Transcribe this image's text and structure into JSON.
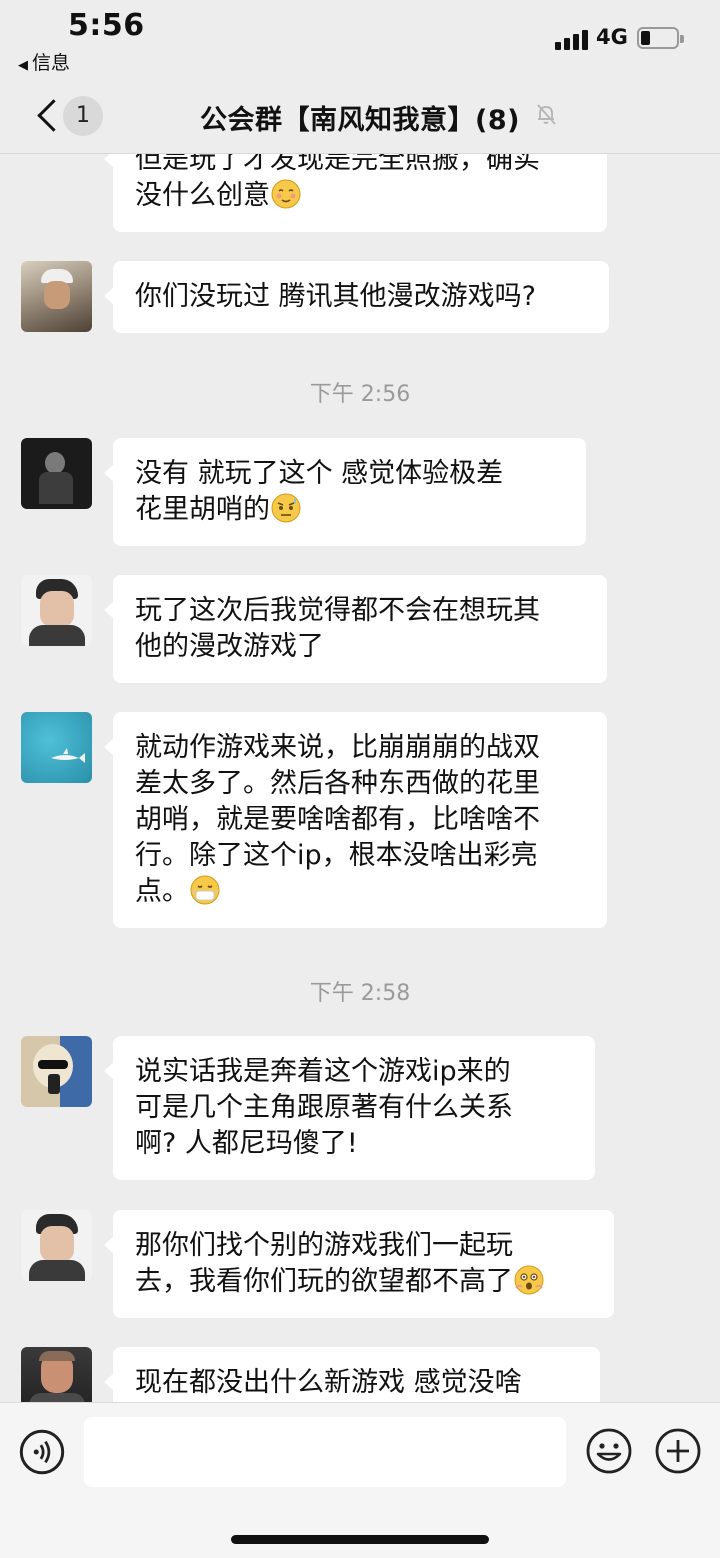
{
  "status_bar": {
    "time": "5:56",
    "back_app": "信息",
    "network": "4G"
  },
  "nav": {
    "unread_count": "1",
    "title": "公会群【南风知我意】(8)"
  },
  "messages": [
    {
      "type": "text",
      "avatar": "avatar-sea",
      "lines": [
        "但是玩了才发现是完全照搬，确实",
        "没什么创意"
      ],
      "emoji": "relieved-face"
    },
    {
      "type": "text",
      "avatar": "avatar-man-cap",
      "lines": [
        "你们没玩过 腾讯其他漫改游戏吗?"
      ]
    },
    {
      "type": "time",
      "text": "下午 2:56"
    },
    {
      "type": "text",
      "avatar": "avatar-dark-figure",
      "lines": [
        "没有  就玩了这个  感觉体验极差",
        "花里胡哨的"
      ],
      "emoji": "sweat-face"
    },
    {
      "type": "text",
      "avatar": "avatar-man-portrait",
      "lines": [
        "玩了这次后我觉得都不会在想玩其",
        "他的漫改游戏了"
      ]
    },
    {
      "type": "text",
      "avatar": "avatar-shark",
      "lines": [
        "就动作游戏来说，比崩崩崩的战双",
        "差太多了。然后各种东西做的花里",
        "胡哨，就是要啥啥都有，比啥啥不",
        "行。除了这个ip，根本没啥出彩亮",
        "点。"
      ],
      "emoji": "mask-face"
    },
    {
      "type": "time",
      "text": "下午 2:58"
    },
    {
      "type": "text",
      "avatar": "avatar-blonde-mirror",
      "lines": [
        "说实话我是奔着这个游戏ip来的",
        "可是几个主角跟原著有什么关系",
        "啊? 人都尼玛傻了!"
      ]
    },
    {
      "type": "text",
      "avatar": "avatar-man-portrait",
      "lines": [
        "那你们找个别的游戏我们一起玩",
        "去，我看你们玩的欲望都不高了"
      ],
      "emoji": "shocked-face"
    },
    {
      "type": "text",
      "avatar": "avatar-bald-man",
      "lines": [
        " 现在都没出什么新游戏  感觉没啥"
      ]
    }
  ],
  "input": {
    "value": "",
    "placeholder": ""
  },
  "colors": {
    "background": "#ededed",
    "bubble": "#ffffff",
    "timestamp": "#9a9a9a"
  }
}
